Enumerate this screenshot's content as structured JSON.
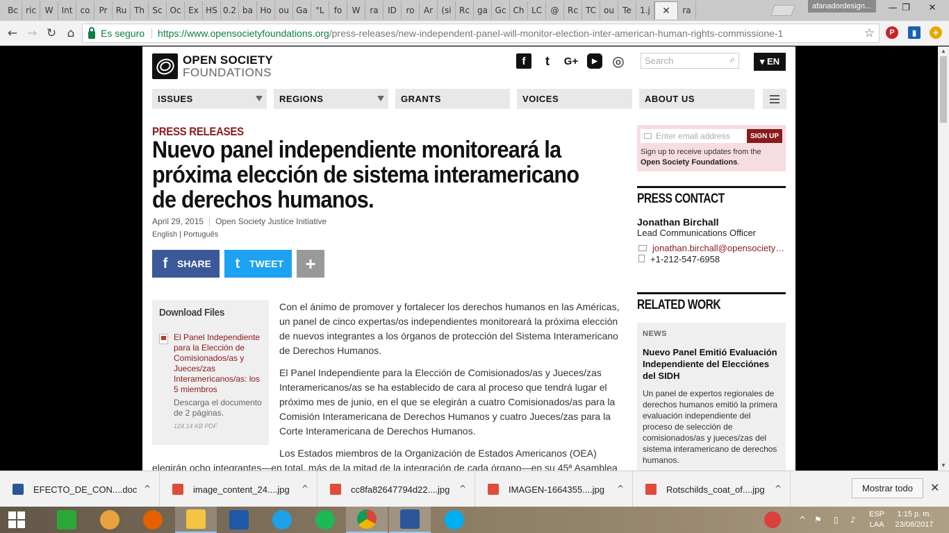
{
  "browser": {
    "tabs": [
      "Bc",
      "ric",
      "W",
      "Int",
      "co",
      "Pr",
      "Ru",
      "Th",
      "Sc",
      "Oc",
      "Ex",
      "HS",
      "0.2",
      "ba",
      "Ho",
      "ou",
      "Ga",
      "\"L",
      "fo",
      "W",
      "ra",
      "ID",
      "ro",
      "Ar",
      "(si",
      "Rc",
      "ga",
      "Gc",
      "Ch",
      "LC",
      "@",
      "Rc",
      "TC",
      "ou",
      "Te",
      "1.j",
      "",
      "ra"
    ],
    "active_tab_close": "✕",
    "profile_name": "afanadordesign...",
    "window_buttons": {
      "minimize": "—",
      "restore": "❐",
      "close": "✕"
    },
    "nav": {
      "back": "←",
      "forward": "→",
      "reload": "↻",
      "home": "⌂"
    },
    "secure_label": "Es seguro",
    "url_host": "https://www.opensocietyfoundations.org",
    "url_path": "/press-releases/new-independent-panel-will-monitor-election-inter-american-human-rights-commissione-1",
    "star": "☆"
  },
  "site": {
    "logo_line1": "OPEN SOCIETY",
    "logo_line2": "FOUNDATIONS",
    "social": {
      "facebook": "f",
      "twitter": "t",
      "googleplus": "G+",
      "youtube": "▶",
      "instagram": "◎"
    },
    "search_placeholder": "Search",
    "lang_button": "▾ EN",
    "nav": [
      {
        "label": "ISSUES",
        "has_caret": true
      },
      {
        "label": "REGIONS",
        "has_caret": true
      },
      {
        "label": "GRANTS",
        "has_caret": false
      },
      {
        "label": "VOICES",
        "has_caret": false
      },
      {
        "label": "ABOUT US",
        "has_caret": false
      }
    ]
  },
  "article": {
    "kicker": "PRESS RELEASES",
    "headline": "Nuevo panel independiente monitoreará la próxima elección de sistema interamericano de derechos humanos.",
    "date": "April 29, 2015",
    "author": "Open Society Justice Initiative",
    "languages": "English | Português",
    "share_label": "SHARE",
    "tweet_label": "TWEET",
    "more_label": "+",
    "downloads": {
      "title": "Download Files",
      "file_link": "El Panel Independiente para la Elección de Comisionados/as y Jueces/zas Interamericanos/as: los 5 miembros",
      "file_desc": "Descarga el documento de 2 páginas.",
      "file_size": "124.14 KB PDF"
    },
    "paragraphs": [
      "Con el ánimo de promover y fortalecer los derechos humanos en las Américas, un panel de cinco expertas/os independientes monitoreará la próxima elección de nuevos integrantes a los órganos de protección del Sistema Interamericano de Derechos Humanos.",
      "El Panel Independiente para la Elección de Comisionados/as y Jueces/zas Interamericanos/as se ha establecido de cara al proceso que tendrá lugar el próximo mes de junio, en el que se elegirán a cuatro Comisionados/as para la Comisión Interamericana de Derechos Humanos y cuatro Jueces/zas para la Corte Interamericana de Derechos Humanos.",
      "Los Estados miembros de la Organización de Estados Americanos (OEA) elegirán ocho integrantes—en total, más de la mitad de la integración de cada órgano—en su 45ª Asamblea"
    ]
  },
  "sidebar": {
    "signup_placeholder": "Enter email address",
    "signup_button": "SIGN UP",
    "signup_text": "Sign up to receive updates from the",
    "signup_org": "Open Society Foundations",
    "signup_period": ".",
    "press_contact_heading": "PRESS CONTACT",
    "contact_name": "Jonathan Birchall",
    "contact_role": "Lead Communications Officer",
    "contact_email": "jonathan.birchall@opensociety…",
    "contact_phone": "+1-212-547-6958",
    "related_heading": "RELATED WORK",
    "related_tag": "NEWS",
    "related_title": "Nuevo Panel Emitió Evaluación Independiente del Elecciónes del SIDH",
    "related_desc": "Un panel de expertos regionales de derechos humanos emitió la primera evaluación independiente del proceso de selección de comisionados/as y jueces/zas del sistema interamericano de derechos humanos."
  },
  "download_shelf": {
    "files": [
      {
        "name": "EFECTO_DE_CON....doc",
        "type": "word"
      },
      {
        "name": "image_content_24....jpg",
        "type": "img"
      },
      {
        "name": "cc8fa82647794d22....jpg",
        "type": "img"
      },
      {
        "name": "IMAGEN-1664355....jpg",
        "type": "img"
      },
      {
        "name": "Rotschilds_coat_of....jpg",
        "type": "img"
      }
    ],
    "chevron": "^",
    "show_all": "Mostrar todo",
    "close": "✕"
  },
  "taskbar": {
    "lang_line1": "ESP",
    "lang_line2": "LAA",
    "time": "1:15 p. m.",
    "date": "23/08/2017"
  },
  "colors": {
    "brand_red": "#8a1b1b",
    "facebook_blue": "#3b5998",
    "twitter_blue": "#1da1f2",
    "secure_green": "#0b8043",
    "signup_bg": "#f6dde2"
  }
}
